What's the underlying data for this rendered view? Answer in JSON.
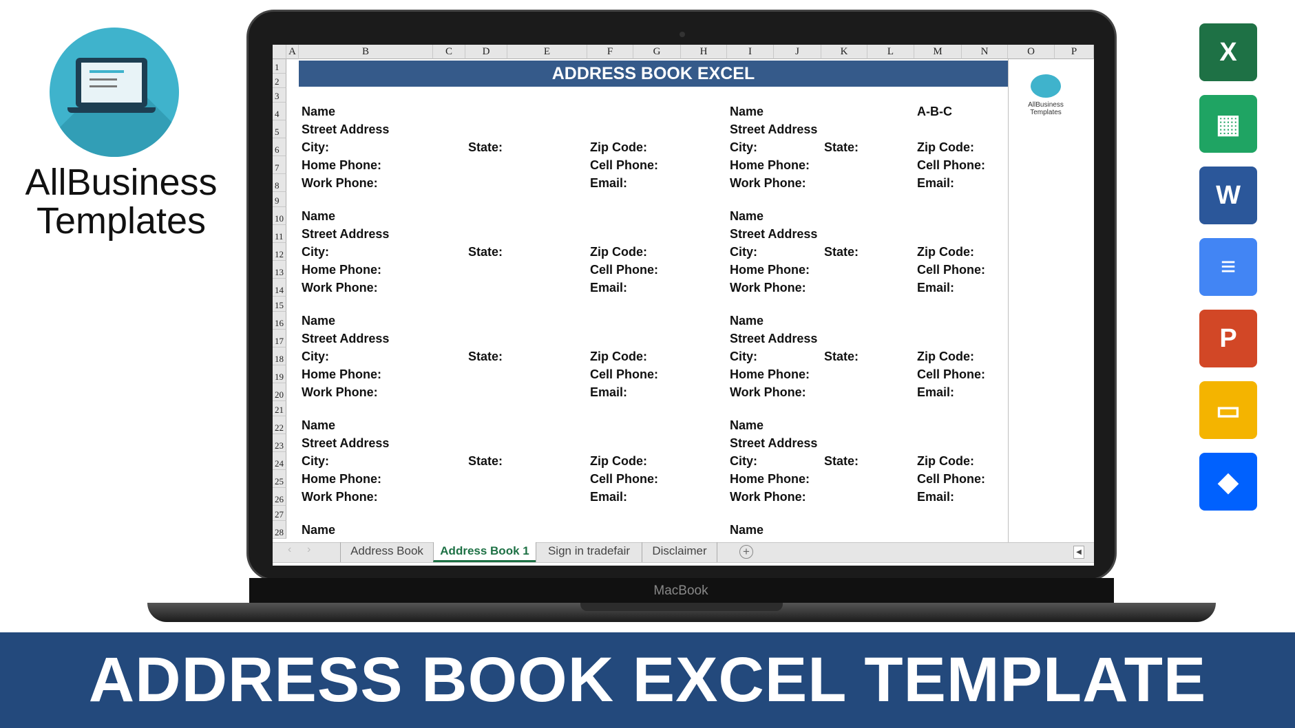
{
  "brand": {
    "line1": "AllBusiness",
    "line2": "Templates",
    "mini_logo": "AllBusiness Templates"
  },
  "laptop": {
    "label": "MacBook"
  },
  "sheet": {
    "title": "ADDRESS BOOK EXCEL",
    "columns": [
      "A",
      "B",
      "C",
      "D",
      "E",
      "F",
      "G",
      "H",
      "I",
      "J",
      "K",
      "L",
      "M",
      "N",
      "O",
      "P"
    ],
    "rows": [
      "1",
      "2",
      "3",
      "4",
      "5",
      "6",
      "7",
      "8",
      "9",
      "10",
      "11",
      "12",
      "13",
      "14",
      "15",
      "16",
      "17",
      "18",
      "19",
      "20",
      "21",
      "22",
      "23",
      "24",
      "25",
      "26",
      "27",
      "28"
    ],
    "field_labels": {
      "name": "Name",
      "street": "Street Address",
      "city": "City:",
      "state": "State:",
      "zip": "Zip Code:",
      "home": "Home Phone:",
      "cell": "Cell Phone:",
      "work": "Work Phone:",
      "email": "Email:"
    },
    "block_start_rows": [
      4,
      10,
      16,
      22,
      28
    ],
    "extra_cell": {
      "row": 4,
      "col": "M",
      "text": "A-B-C"
    },
    "tabs": [
      {
        "label": "Address Book",
        "active": false
      },
      {
        "label": "Address Book 1",
        "active": true
      },
      {
        "label": "Sign in tradefair",
        "active": false
      },
      {
        "label": "Disclaimer",
        "active": false
      }
    ],
    "accent": "#1e7145",
    "title_color": "#355a8a"
  },
  "app_icons": [
    {
      "name": "excel-icon",
      "letter": "X",
      "color": "#1e7145"
    },
    {
      "name": "google-sheets-icon",
      "letter": "▦",
      "color": "#1fa463"
    },
    {
      "name": "word-icon",
      "letter": "W",
      "color": "#2b579a"
    },
    {
      "name": "google-docs-icon",
      "letter": "≡",
      "color": "#4285f4"
    },
    {
      "name": "powerpoint-icon",
      "letter": "P",
      "color": "#d24726"
    },
    {
      "name": "google-slides-icon",
      "letter": "▭",
      "color": "#f4b400"
    },
    {
      "name": "dropbox-icon",
      "letter": "◆",
      "color": "#0061fe"
    }
  ],
  "banner": {
    "text": "ADDRESS BOOK EXCEL TEMPLATE",
    "color": "#23497c"
  }
}
